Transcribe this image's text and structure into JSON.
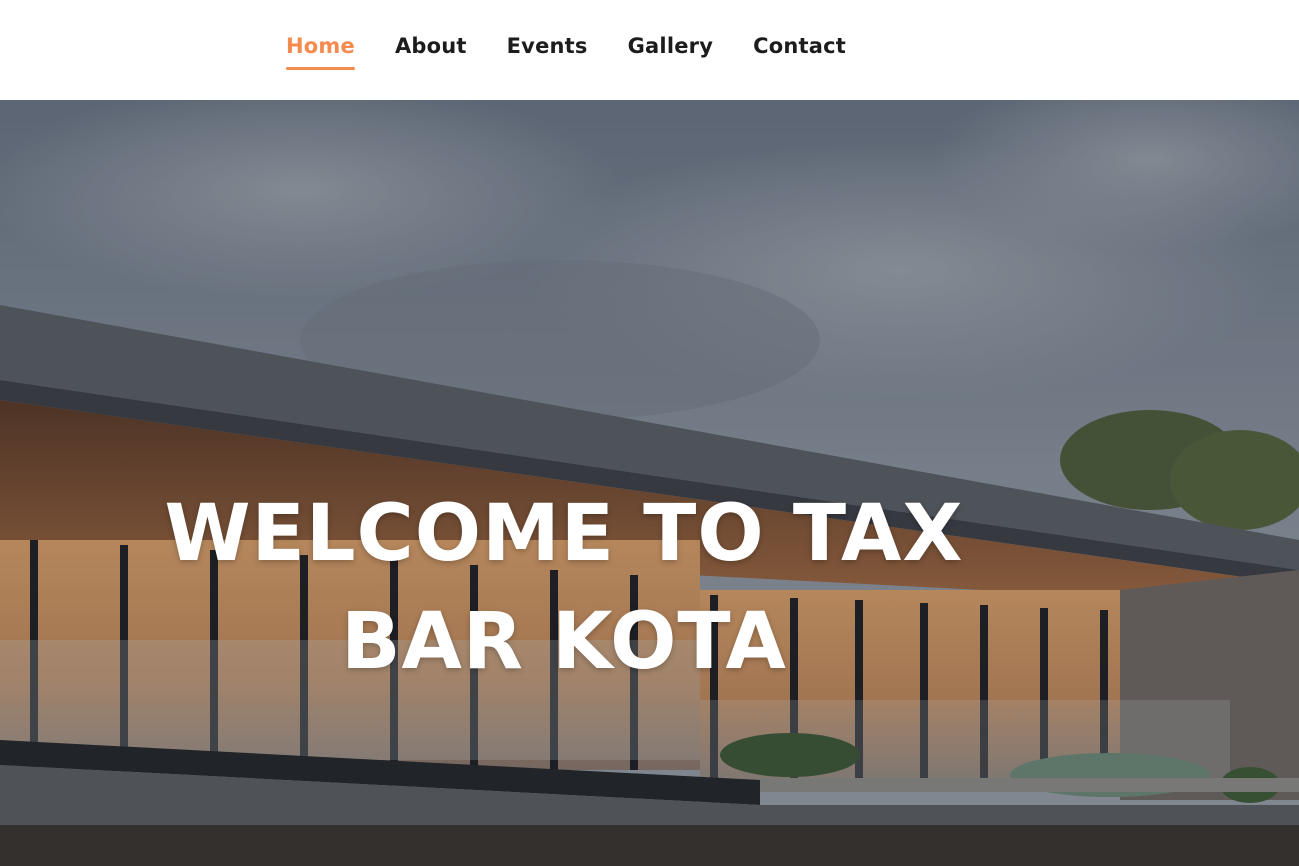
{
  "nav": {
    "items": [
      {
        "label": "Home",
        "active": true
      },
      {
        "label": "About",
        "active": false
      },
      {
        "label": "Events",
        "active": false
      },
      {
        "label": "Gallery",
        "active": false
      },
      {
        "label": "Contact",
        "active": false
      }
    ],
    "accent_color": "#f58a4f"
  },
  "hero": {
    "title": "WELCOME TO TAX BAR KOTA",
    "background": "modern building exterior at dusk with cloudy sky"
  }
}
